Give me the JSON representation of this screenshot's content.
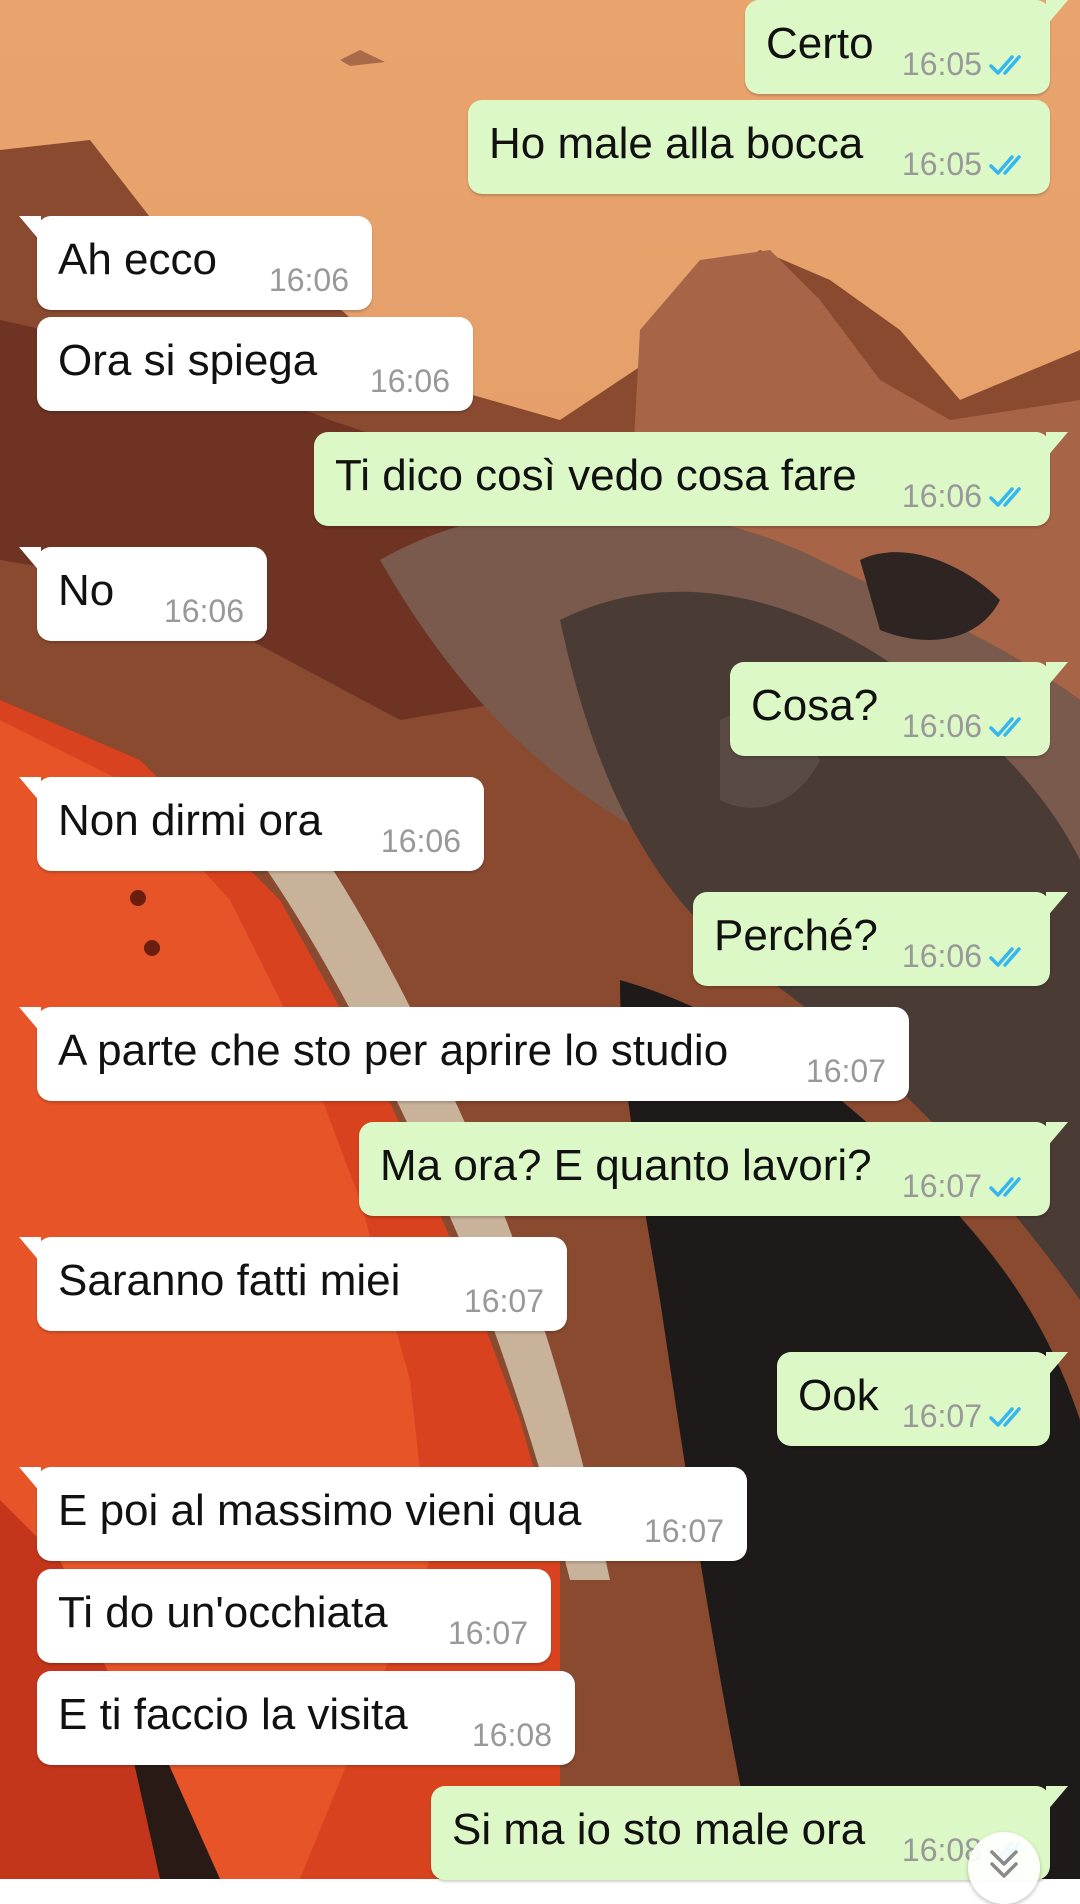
{
  "chat": {
    "messages": [
      {
        "direction": "out",
        "text": "Certo",
        "time": "16:05",
        "status": "read"
      },
      {
        "direction": "out",
        "text": "Ho male alla bocca",
        "time": "16:05",
        "status": "read"
      },
      {
        "direction": "in",
        "text": "Ah ecco",
        "time": "16:06"
      },
      {
        "direction": "in",
        "text": "Ora si spiega",
        "time": "16:06"
      },
      {
        "direction": "out",
        "text": "Ti dico così vedo cosa fare",
        "time": "16:06",
        "status": "read"
      },
      {
        "direction": "in",
        "text": "No",
        "time": "16:06"
      },
      {
        "direction": "out",
        "text": "Cosa?",
        "time": "16:06",
        "status": "read"
      },
      {
        "direction": "in",
        "text": "Non dirmi ora",
        "time": "16:06"
      },
      {
        "direction": "out",
        "text": "Perché?",
        "time": "16:06",
        "status": "read"
      },
      {
        "direction": "in",
        "text": "A parte che sto per aprire lo studio",
        "time": "16:07"
      },
      {
        "direction": "out",
        "text": "Ma ora? E quanto lavori?",
        "time": "16:07",
        "status": "read"
      },
      {
        "direction": "in",
        "text": "Saranno fatti miei",
        "time": "16:07"
      },
      {
        "direction": "out",
        "text": "Ook",
        "time": "16:07",
        "status": "read"
      },
      {
        "direction": "in",
        "text": "E poi al massimo vieni qua",
        "time": "16:07"
      },
      {
        "direction": "in",
        "text": "Ti do un'occhiata",
        "time": "16:07"
      },
      {
        "direction": "in",
        "text": "E ti faccio la visita",
        "time": "16:08"
      },
      {
        "direction": "out",
        "text": "Si ma io sto male ora",
        "time": "16:08",
        "status": "read"
      }
    ]
  },
  "colors": {
    "incoming_bubble": "#ffffff",
    "outgoing_bubble": "#dcf8c6",
    "timestamp": "#999999",
    "read_ticks": "#34b7f1",
    "message_text": "#111111"
  },
  "icons": {
    "read_receipt": "double-check-icon",
    "scroll_down": "chevron-double-down-icon"
  }
}
